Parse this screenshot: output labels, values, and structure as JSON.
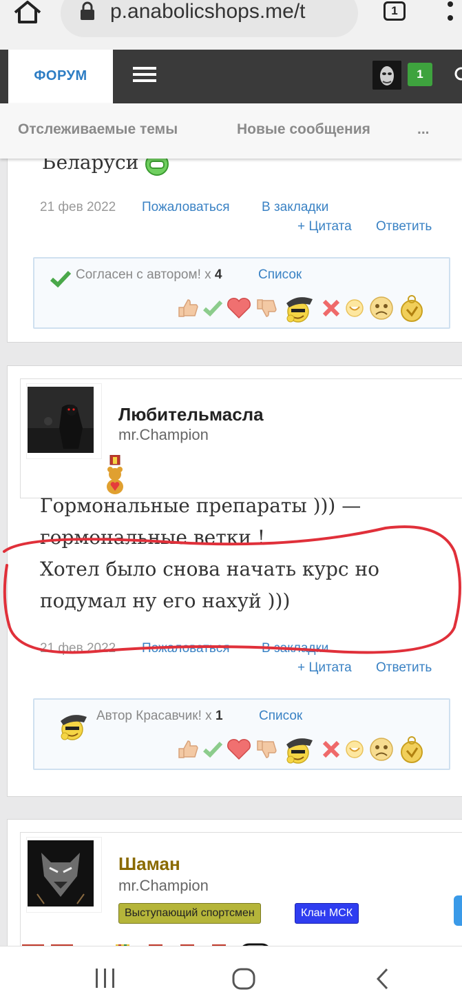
{
  "browser": {
    "url": "p.anabolicshops.me/t",
    "tab_count": "1"
  },
  "nav": {
    "forum_label": "ФОРУМ",
    "notifications": "1"
  },
  "subnav": {
    "watched": "Отслеживаемые темы",
    "new_messages": "Новые сообщения",
    "more": "..."
  },
  "posts": [
    {
      "partial_text": "Беларуси",
      "date": "21 фев 2022",
      "report": "Пожаловаться",
      "bookmark": "В закладки",
      "quote": "+ Цитата",
      "reply": "Ответить",
      "reaction_summary": "Согласен с автором! x",
      "reaction_count": "4",
      "reaction_list": "Список"
    },
    {
      "username": "Любительмасла",
      "user_title": "mr.Champion",
      "text_lines": [
        "Гормональные препараты ))) —",
        "гормональные ветки !",
        "Хотел было снова начать курс но",
        "подумал ну его нахуй )))"
      ],
      "date": "21 фев 2022",
      "report": "Пожаловаться",
      "bookmark": "В закладки",
      "quote": "+ Цитата",
      "reply": "Ответить",
      "reaction_summary": "Автор Красавчик! x",
      "reaction_count": "1",
      "reaction_list": "Список"
    },
    {
      "username": "Шаман",
      "user_title": "mr.Champion",
      "banners": [
        "Выступающий спортсмен",
        "Клан МСК"
      ]
    }
  ],
  "colors": {
    "link": "#3a82c4",
    "nav_bg": "#3a3a3a",
    "accent": "#2d7dc4",
    "badge": "#3ea33e",
    "annotation": "#e0303a"
  },
  "icons": [
    "home-icon",
    "lock-icon",
    "menu-dots-icon",
    "hamburger-icon",
    "search-icon",
    "like-icon",
    "agree-icon",
    "love-icon",
    "dislike-icon",
    "cool-icon",
    "cross-icon",
    "smile-icon",
    "sad-icon",
    "medal-icon"
  ]
}
